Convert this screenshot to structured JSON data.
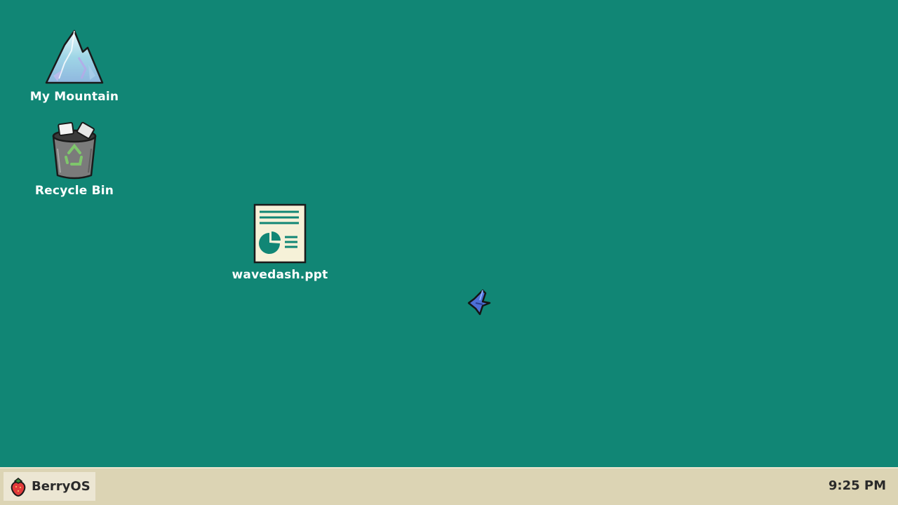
{
  "desktop": {
    "background_color": "#118675",
    "icons": [
      {
        "label": "My Mountain",
        "icon": "mountain-icon"
      },
      {
        "label": "Recycle Bin",
        "icon": "recycle-bin-icon"
      },
      {
        "label": "wavedash.ppt",
        "icon": "presentation-file-icon"
      }
    ]
  },
  "cursor": {
    "icon": "bird-cursor-icon"
  },
  "taskbar": {
    "background_color": "#dcd4b4",
    "start": {
      "label": "BerryOS",
      "icon": "strawberry-icon"
    },
    "clock": "9:25 PM"
  }
}
